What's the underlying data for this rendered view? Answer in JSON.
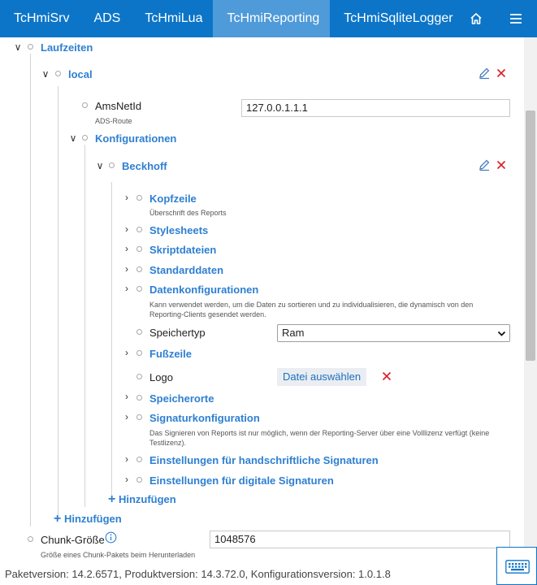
{
  "nav": {
    "tabs": [
      {
        "label": "TcHmiSrv"
      },
      {
        "label": "ADS"
      },
      {
        "label": "TcHmiLua"
      },
      {
        "label": "TcHmiReporting",
        "active": true
      },
      {
        "label": "TcHmiSqliteLogger"
      }
    ],
    "accent": "#0c75c8",
    "active_tab_color": "#4f9ad9",
    "home_icon": "home-icon",
    "menu_icon": "hamburger-menu-icon"
  },
  "tree": {
    "laufzeiten": "Laufzeiten",
    "local": "local",
    "amsnetid": {
      "label": "AmsNetId",
      "description": "ADS-Route",
      "value": "127.0.0.1.1.1"
    },
    "konfigurationen": "Konfigurationen",
    "beckhoff": "Beckhoff",
    "items": {
      "kopfzeile": {
        "label": "Kopfzeile",
        "description": "Überschrift des Reports"
      },
      "stylesheets": {
        "label": "Stylesheets"
      },
      "skriptdateien": {
        "label": "Skriptdateien"
      },
      "standarddaten": {
        "label": "Standarddaten"
      },
      "datenkonfigurationen": {
        "label": "Datenkonfigurationen",
        "description": "Kann verwendet werden, um die Daten zu sortieren und zu individualisieren, die dynamisch von den Reporting-Clients gesendet werden."
      },
      "speichertyp": {
        "label": "Speichertyp",
        "value": "Ram"
      },
      "fusszeile": {
        "label": "Fußzeile"
      },
      "logo": {
        "label": "Logo",
        "button": "Datei auswählen"
      },
      "speicherorte": {
        "label": "Speicherorte"
      },
      "signaturkonfiguration": {
        "label": "Signaturkonfiguration",
        "description": "Das Signieren von Reports ist nur möglich, wenn der Reporting-Server über eine Volllizenz verfügt (keine Testlizenz)."
      },
      "handschriftlich": {
        "label": "Einstellungen für handschriftliche Signaturen"
      },
      "digital": {
        "label": "Einstellungen für digitale Signaturen"
      }
    },
    "add_inner": "Hinzufügen",
    "add_outer": "Hinzufügen",
    "chunk": {
      "label": "Chunk-Größe",
      "description": "Größe eines Chunk-Pakets beim Herunterladen",
      "value": "1048576"
    },
    "edit_icon": "pencil-icon",
    "delete_icon": "close-icon",
    "edit_color": "#4a7cc0",
    "delete_color": "#d9232d"
  },
  "footer": {
    "version_text": "Paketversion: 14.2.6571, Produktversion: 14.3.72.0, Konfigurationsversion: 1.0.1.8"
  }
}
